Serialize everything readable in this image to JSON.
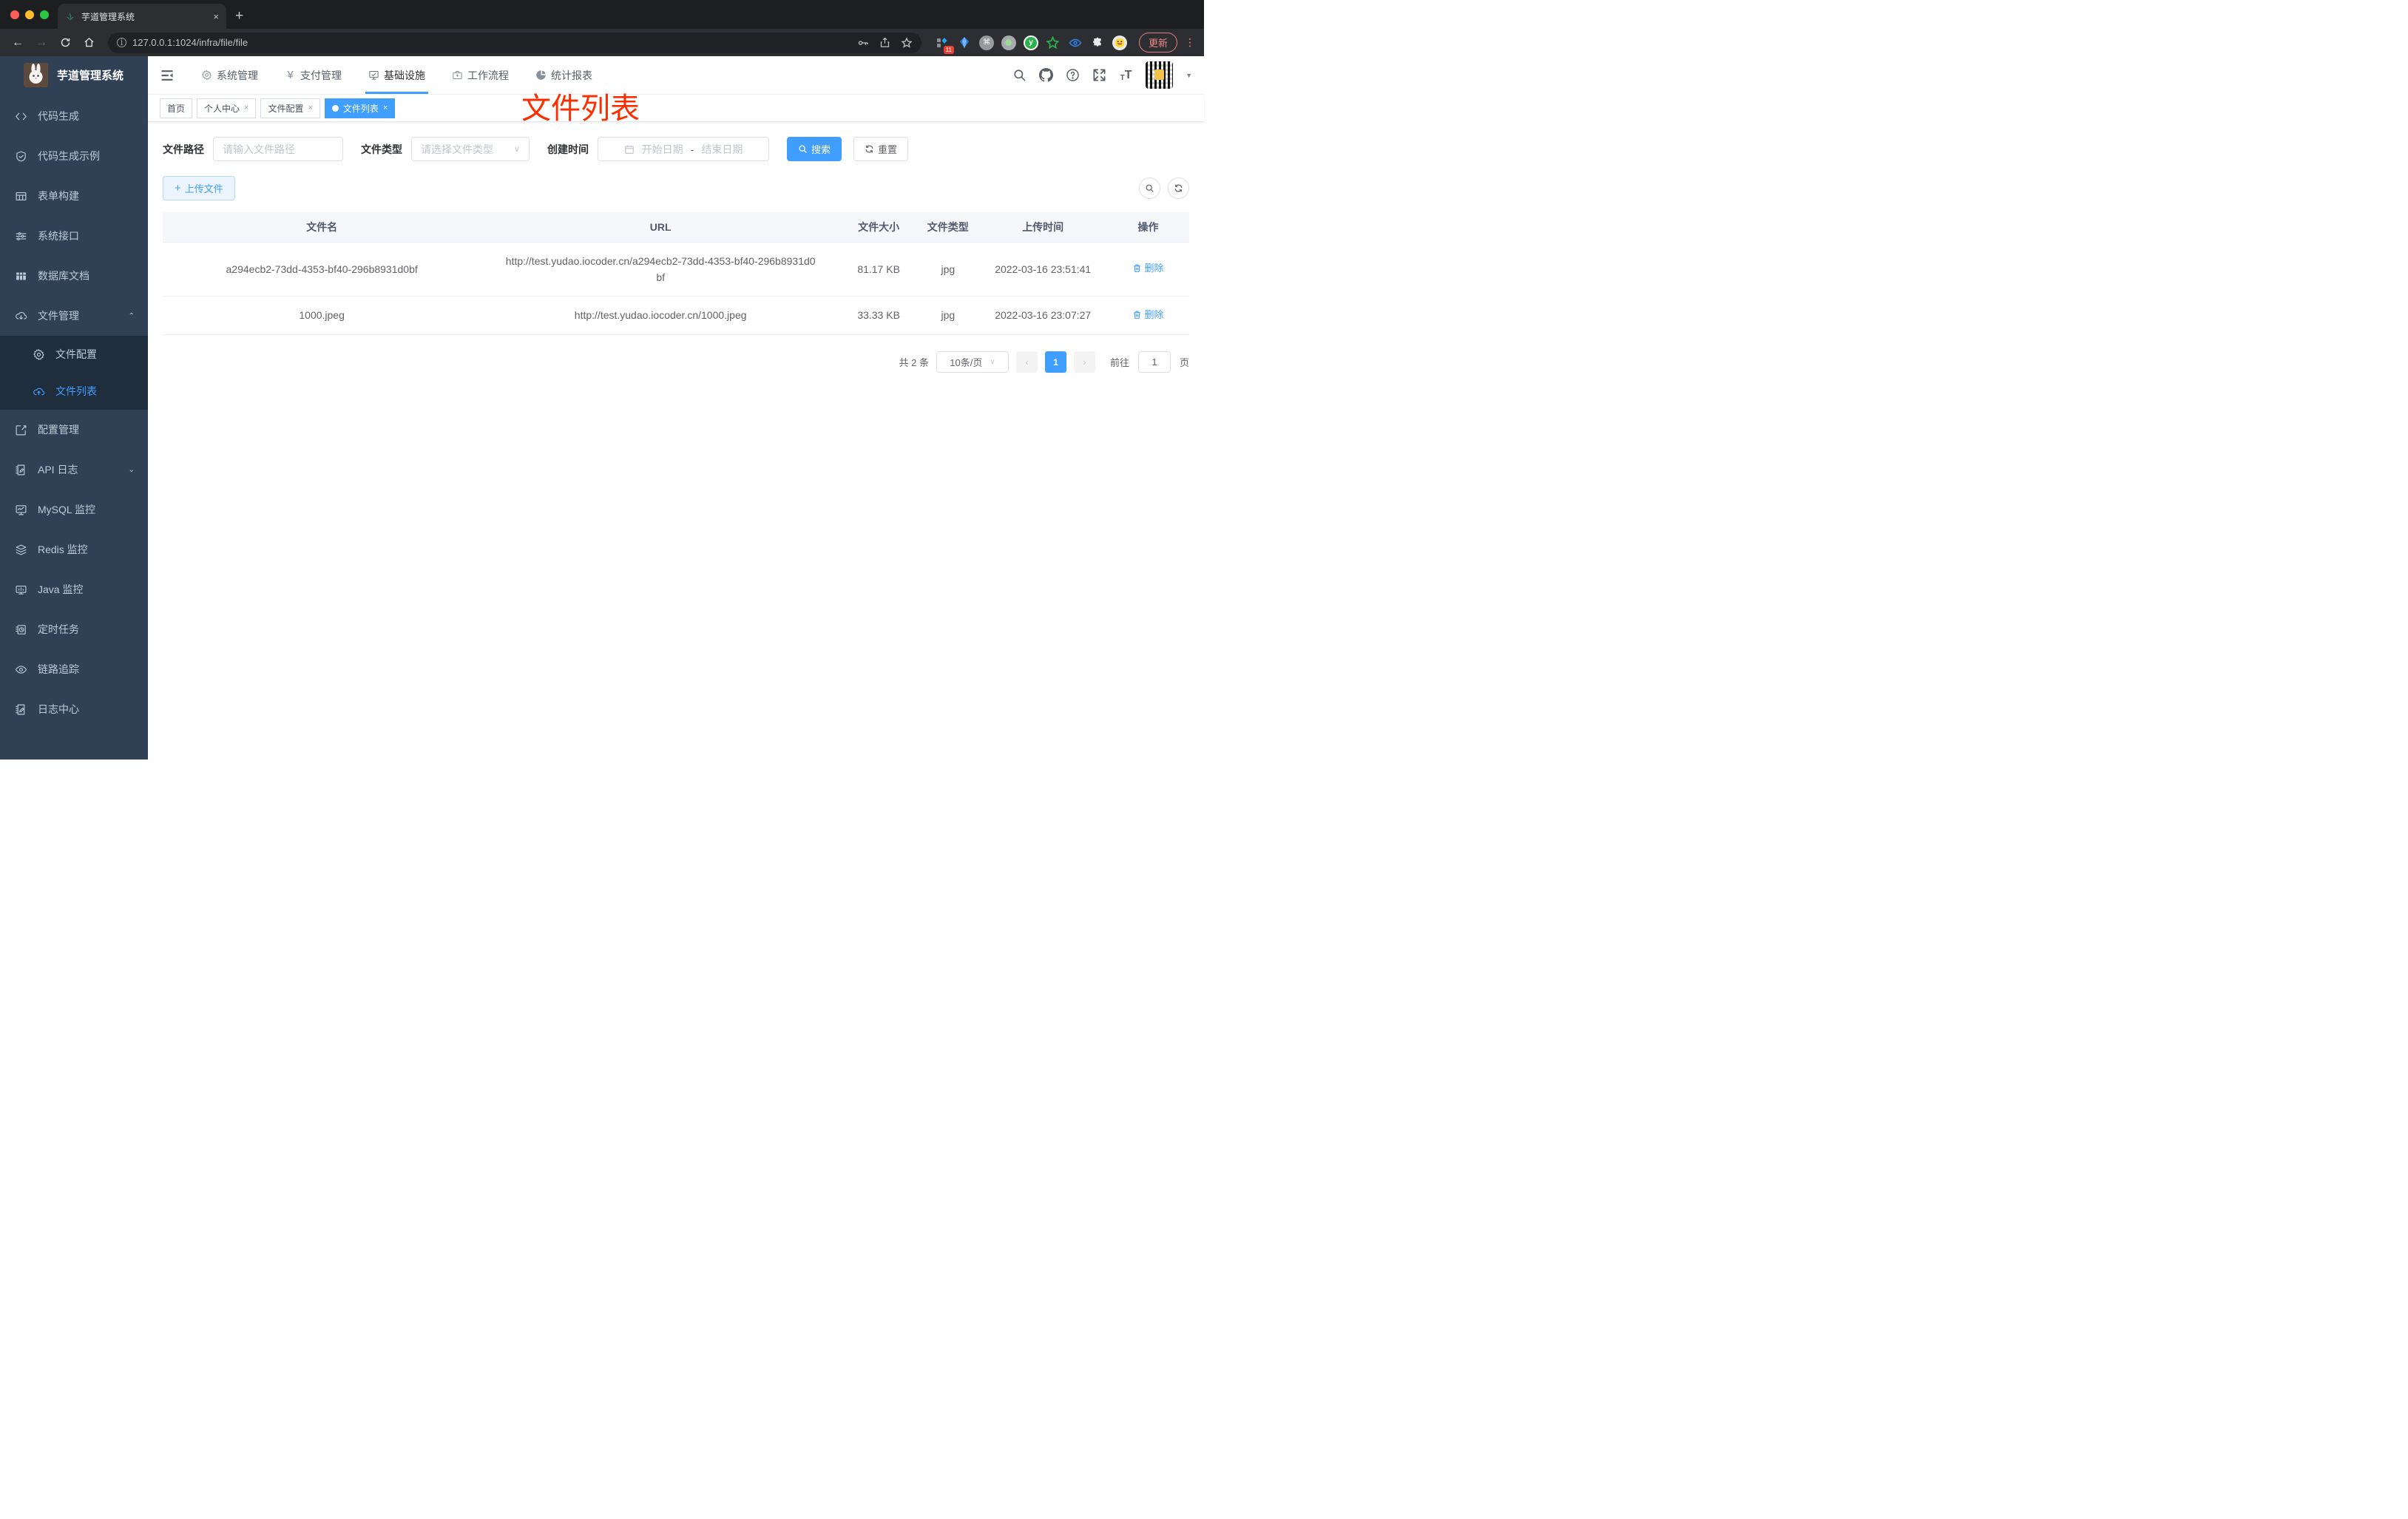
{
  "browser": {
    "tab_title": "芋道管理系统",
    "url": "127.0.0.1:1024/infra/file/file",
    "new_tab": "+",
    "close_tab": "×",
    "update_label": "更新",
    "extension_badge": "11"
  },
  "sidebar": {
    "title": "芋道管理系统",
    "items": [
      {
        "label": "代码生成",
        "icon": "code-icon"
      },
      {
        "label": "代码生成示例",
        "icon": "shield-check-icon"
      },
      {
        "label": "表单构建",
        "icon": "form-icon"
      },
      {
        "label": "系统接口",
        "icon": "sliders-icon"
      },
      {
        "label": "数据库文档",
        "icon": "database-icon"
      },
      {
        "label": "文件管理",
        "icon": "cloud-download-icon",
        "expanded": true
      },
      {
        "label": "文件配置",
        "icon": "gear-icon",
        "submenu": true
      },
      {
        "label": "文件列表",
        "icon": "cloud-upload-icon",
        "submenu": true,
        "active": true
      },
      {
        "label": "配置管理",
        "icon": "edit-icon"
      },
      {
        "label": "API 日志",
        "icon": "log-edit-icon",
        "collapsed": true
      },
      {
        "label": "MySQL 监控",
        "icon": "mysql-monitor-icon"
      },
      {
        "label": "Redis 监控",
        "icon": "redis-layers-icon"
      },
      {
        "label": "Java 监控",
        "icon": "java-monitor-icon"
      },
      {
        "label": "定时任务",
        "icon": "timer-icon"
      },
      {
        "label": "链路追踪",
        "icon": "eye-icon"
      },
      {
        "label": "日志中心",
        "icon": "log-center-icon"
      }
    ]
  },
  "navbar": {
    "menus": [
      {
        "label": "系统管理",
        "icon": "gear-icon"
      },
      {
        "label": "支付管理",
        "icon": "yen-icon"
      },
      {
        "label": "基础设施",
        "icon": "infrastructure-icon",
        "active": true
      },
      {
        "label": "工作流程",
        "icon": "briefcase-icon"
      },
      {
        "label": "统计报表",
        "icon": "pie-chart-icon"
      }
    ]
  },
  "tags": [
    {
      "label": "首页",
      "closable": false
    },
    {
      "label": "个人中心",
      "closable": true
    },
    {
      "label": "文件配置",
      "closable": true
    },
    {
      "label": "文件列表",
      "closable": true,
      "active": true
    }
  ],
  "annotation": "文件列表",
  "filters": {
    "path_label": "文件路径",
    "path_placeholder": "请输入文件路径",
    "type_label": "文件类型",
    "type_placeholder": "请选择文件类型",
    "date_label": "创建时间",
    "date_start": "开始日期",
    "date_sep": "-",
    "date_end": "结束日期",
    "search_label": "搜索",
    "reset_label": "重置"
  },
  "toolbar": {
    "upload_label": "上传文件"
  },
  "table": {
    "columns": [
      "文件名",
      "URL",
      "文件大小",
      "文件类型",
      "上传时间",
      "操作"
    ],
    "rows": [
      {
        "name": "a294ecb2-73dd-4353-bf40-296b8931d0bf",
        "url": "http://test.yudao.iocoder.cn/a294ecb2-73dd-4353-bf40-296b8931d0bf",
        "size": "81.17 KB",
        "type": "jpg",
        "time": "2022-03-16 23:51:41",
        "action": "删除"
      },
      {
        "name": "1000.jpeg",
        "url": "http://test.yudao.iocoder.cn/1000.jpeg",
        "size": "33.33 KB",
        "type": "jpg",
        "time": "2022-03-16 23:07:27",
        "action": "删除"
      }
    ]
  },
  "pagination": {
    "total": "共 2 条",
    "page_size": "10条/页",
    "current_page": "1",
    "goto_label": "前往",
    "goto_value": "1",
    "page_unit": "页"
  },
  "colors": {
    "accent": "#409eff",
    "annotation_red": "#fb2e01",
    "sidebar_bg": "#304156",
    "submenu_bg": "#1f2d3d",
    "active_tag_bg": "#409eff"
  }
}
